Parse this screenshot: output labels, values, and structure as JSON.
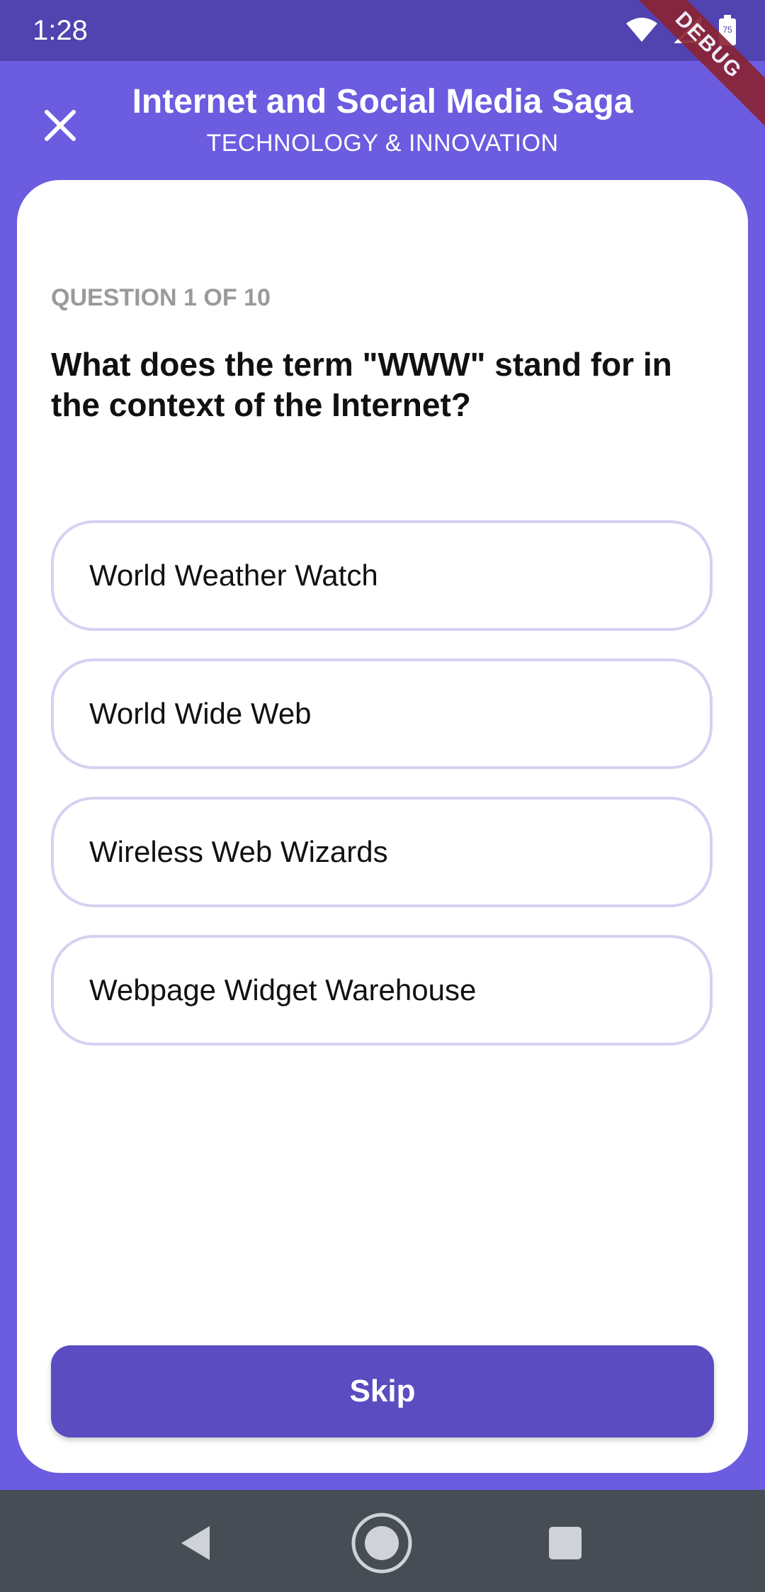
{
  "status_bar": {
    "time": "1:28",
    "battery_level": "75",
    "icons": [
      "wifi-icon",
      "signal-icon",
      "battery-icon"
    ]
  },
  "debug_banner": "DEBUG",
  "header": {
    "title": "Internet and Social Media Saga",
    "subtitle": "TECHNOLOGY & INNOVATION",
    "close_icon": "close-icon"
  },
  "quiz": {
    "counter": "QUESTION 1 OF 10",
    "question": "What does the term \"WWW\" stand for in the context of the Internet?",
    "options": [
      {
        "label": "World Weather Watch"
      },
      {
        "label": "World Wide Web"
      },
      {
        "label": "Wireless Web Wizards"
      },
      {
        "label": "Webpage Widget Warehouse"
      }
    ],
    "skip_label": "Skip"
  },
  "nav_bar": {
    "buttons": [
      "back-icon",
      "home-icon",
      "recents-icon"
    ]
  },
  "colors": {
    "primary": "#6c5ce0",
    "status_bar": "#5143b0",
    "skip_button": "#5b4cc2",
    "option_border": "#d6d0f2",
    "nav_bar": "#464d55",
    "debug_ribbon": "#8b2232"
  }
}
